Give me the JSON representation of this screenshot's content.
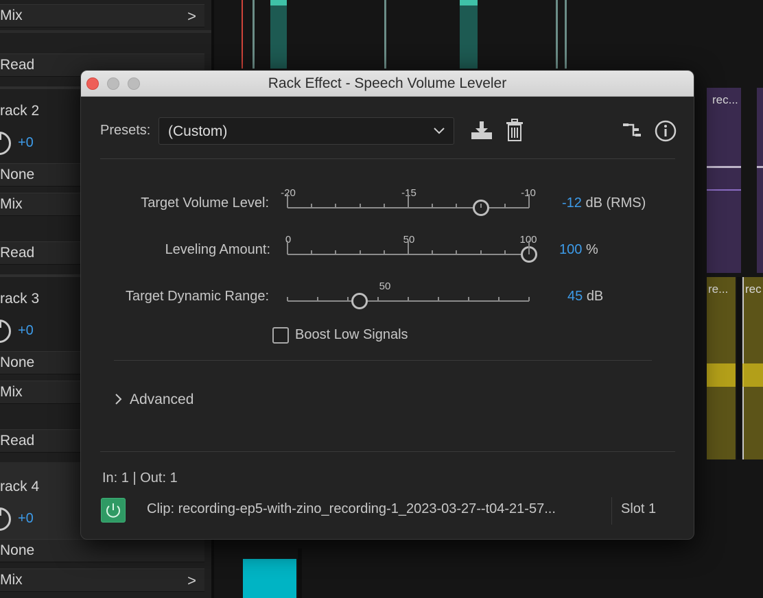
{
  "dialog": {
    "title": "Rack Effect - Speech Volume Leveler",
    "presets_label": "Presets:",
    "preset_value": "(Custom)",
    "params": [
      {
        "label": "Target Volume Level:",
        "value": "-12",
        "unit": "dB (RMS)",
        "ticks": [
          "-20",
          "-15",
          "-10"
        ],
        "min": -20,
        "max": -10,
        "current": -12
      },
      {
        "label": "Leveling Amount:",
        "value": "100",
        "unit": "%",
        "ticks": [
          "0",
          "50",
          "100"
        ],
        "min": 0,
        "max": 100,
        "current": 100
      },
      {
        "label": "Target Dynamic Range:",
        "value": "45",
        "unit": "dB",
        "ticks": [
          "50"
        ],
        "current": 45
      }
    ],
    "boost_label": "Boost Low Signals",
    "boost_checked": false,
    "advanced_label": "Advanced",
    "io_text": "In: 1 | Out: 1",
    "clip_text": "Clip: recording-ep5-with-zino_recording-1_2023-03-27--t04-21-57...",
    "slot_text": "Slot 1",
    "power_color": "#2f9a64"
  },
  "left_panel": {
    "rows": [
      {
        "text": "Mix",
        "chevron": ">"
      },
      {
        "text": "Read"
      },
      {
        "text": "rack 2"
      },
      {
        "text": "+0"
      },
      {
        "text": "None"
      },
      {
        "text": "Mix"
      },
      {
        "text": "Read"
      },
      {
        "text": "rack 3"
      },
      {
        "text": "+0"
      },
      {
        "text": "None"
      },
      {
        "text": "Mix"
      },
      {
        "text": "Read"
      },
      {
        "text": "rack 4"
      },
      {
        "text": "+0"
      },
      {
        "text": "None"
      },
      {
        "text": "Mix",
        "chevron": ">"
      }
    ]
  },
  "timeline": {
    "clip_labels": [
      "rec...",
      "re...",
      "rec"
    ],
    "accent_color": "#3d9be9",
    "clip_colors": {
      "purple": "#3a2a4f",
      "yellow": "#5c5418",
      "teal": "#00b4c4"
    }
  }
}
